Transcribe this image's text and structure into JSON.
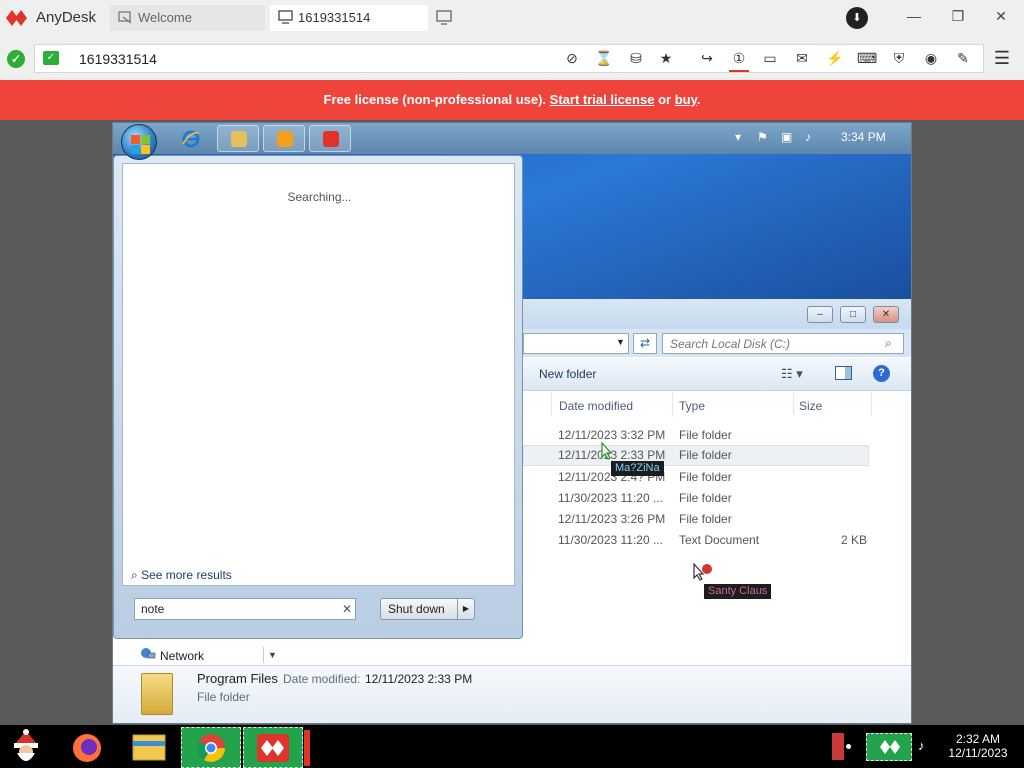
{
  "anydesk": {
    "app_name": "AnyDesk",
    "tabs": [
      {
        "label": "Welcome",
        "icon": "welcome-tab-icon"
      },
      {
        "label": "1619331514",
        "icon": "monitor-icon"
      }
    ],
    "address": "1619331514",
    "banner": {
      "prefix": "Free license (non-professional use).",
      "trial_link": "Start trial license",
      "or": "or",
      "buy_link": "buy",
      "suffix": "."
    },
    "colors": {
      "banner": "#ef443b",
      "accent_red": "#e0342b",
      "connected_green": "#2eae37"
    }
  },
  "remote": {
    "taskbar_time": "3:34 PM",
    "start_menu": {
      "status": "Searching...",
      "see_more": "See more results",
      "search_value": "note",
      "shutdown_label": "Shut down"
    },
    "explorer": {
      "search_placeholder": "Search Local Disk (C:)",
      "new_folder": "New folder",
      "columns": [
        "Date modified",
        "Type",
        "Size"
      ],
      "rows": [
        {
          "date": "12/11/2023 3:32 PM",
          "type": "File folder",
          "size": ""
        },
        {
          "date": "12/11/2023 2:33 PM",
          "type": "File folder",
          "size": ""
        },
        {
          "date": "12/11/2023 2:4? PM",
          "type": "File folder",
          "size": ""
        },
        {
          "date": "11/30/2023 11:20 ...",
          "type": "File folder",
          "size": ""
        },
        {
          "date": "12/11/2023 3:26 PM",
          "type": "File folder",
          "size": ""
        },
        {
          "date": "11/30/2023 11:20 ...",
          "type": "Text Document",
          "size": "2 KB"
        }
      ],
      "nav_item": "Network",
      "details": {
        "name": "Program Files",
        "date_label": "Date modified:",
        "date_value": "12/11/2023 2:33 PM",
        "kind": "File folder"
      }
    },
    "cursor_tags": [
      "Ma?ZiNa",
      "Santy Claus"
    ]
  },
  "local_taskbar": {
    "time": "2:32 AM",
    "date": "12/11/2023"
  }
}
